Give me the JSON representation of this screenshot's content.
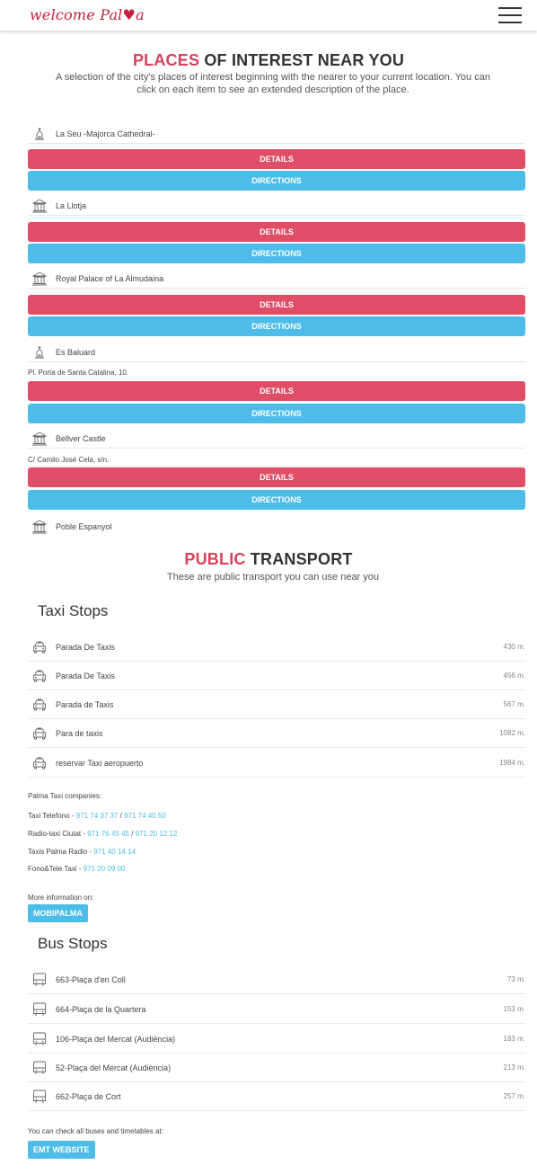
{
  "header": {
    "logo_text_a": "welcome Pal",
    "logo_text_heart": "♥",
    "logo_text_b": "a"
  },
  "places": {
    "title_accent": "PLACES",
    "title_rest": " OF INTEREST NEAR YOU",
    "intro_line1": "A selection of the city's places of interest beginning with the nearer to your current location. You can",
    "intro_line2": "click on each item to see an extended description of the place.",
    "details_label": "DETAILS",
    "directions_label": "DIRECTIONS",
    "items": [
      {
        "name": "La Seu -Majorca Cathedral-",
        "icon": "church-icon"
      },
      {
        "name": "La Llotja",
        "icon": "monument-icon"
      },
      {
        "name": "Royal Palace of La Almudaina",
        "icon": "monument-icon"
      },
      {
        "name": "Es Baluard",
        "icon": "church-icon",
        "address": "Pl. Porta de Santa Catalina, 10."
      },
      {
        "name": "Bellver Castle",
        "icon": "monument-icon",
        "address": "C/ Camilo José Cela, s/n."
      },
      {
        "name": "Poble Espanyol",
        "icon": "monument-icon"
      }
    ]
  },
  "transport": {
    "title_accent": "PUBLIC",
    "title_rest": " TRANSPORT",
    "subtitle": "These are public transport you can use near you",
    "taxi": {
      "heading": "Taxi Stops",
      "stops": [
        {
          "name": "Parada De Taxis",
          "distance": "430 m."
        },
        {
          "name": "Parada De Taxis",
          "distance": "456 m."
        },
        {
          "name": "Parada de Taxis",
          "distance": "567 m."
        },
        {
          "name": "Para de taxis",
          "distance": "1082 m."
        },
        {
          "name": "reservar Taxi aeropuerto",
          "distance": "1984 m."
        }
      ],
      "companies_label": "Palma Taxi companies:",
      "companies": [
        {
          "name": "Taxi Telefono - ",
          "phone1": "971 74 37 37",
          "sep": " / ",
          "phone2": "971 74 40 50"
        },
        {
          "name": "Radio-taxi Ciutat - ",
          "phone1": "971 76 45 45",
          "sep": " / ",
          "phone2": "971 20 12 12"
        },
        {
          "name": "Taxis Palma Radio - ",
          "phone1": "971 40 14 14"
        },
        {
          "name": "Fono&Tele Taxi - ",
          "phone1": "971 20 09 00"
        }
      ],
      "more_info": "More information on:",
      "button": "MOBIPALMA"
    },
    "bus": {
      "heading": "Bus Stops",
      "stops": [
        {
          "name": "663-Plaça d'en Coll",
          "distance": "73 m."
        },
        {
          "name": "664-Plaça de la Quartera",
          "distance": "153 m."
        },
        {
          "name": "106-Plaça del Mercat (Audiència)",
          "distance": "183 m."
        },
        {
          "name": "52-Plaça del Mercat (Audiència)",
          "distance": "213 m."
        },
        {
          "name": "662-Plaça de Cort",
          "distance": "257 m."
        }
      ],
      "check_label": "You can check all buses and timetables at:",
      "button": "EMT WEBSITE"
    }
  },
  "colors": {
    "accent_red": "#df4d66",
    "accent_blue": "#4dbce8",
    "logo_red": "#c4223d"
  }
}
